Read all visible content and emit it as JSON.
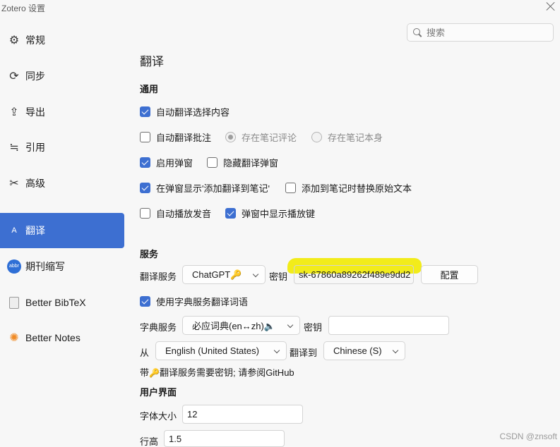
{
  "window": {
    "title": "Zotero 设置"
  },
  "search": {
    "placeholder": "搜索"
  },
  "sidebar": {
    "items": [
      {
        "label": "常规",
        "icon": "gear-icon"
      },
      {
        "label": "同步",
        "icon": "sync-icon"
      },
      {
        "label": "导出",
        "icon": "export-icon"
      },
      {
        "label": "引用",
        "icon": "cite-icon"
      },
      {
        "label": "高级",
        "icon": "tools-icon"
      },
      {
        "label": "翻译",
        "icon": "translate-icon",
        "active": true
      },
      {
        "label": "期刊缩写",
        "icon": "abbr-icon"
      },
      {
        "label": "Better BibTeX",
        "icon": "bibtex-icon"
      },
      {
        "label": "Better Notes",
        "icon": "notes-icon"
      }
    ]
  },
  "pane": {
    "title": "翻译",
    "general": {
      "heading": "通用",
      "auto_translate_selection": {
        "label": "自动翻译选择内容",
        "checked": true
      },
      "auto_translate_annotation": {
        "label": "自动翻译批注",
        "checked": false
      },
      "radio_store_comment": {
        "label": "存在笔记评论",
        "selected": true
      },
      "radio_store_body": {
        "label": "存在笔记本身",
        "selected": false
      },
      "enable_popup": {
        "label": "启用弹窗",
        "checked": true
      },
      "hide_popup": {
        "label": "隐藏翻译弹窗",
        "checked": false
      },
      "show_add_to_note": {
        "label": "在弹窗显示'添加翻译到笔记'",
        "checked": true
      },
      "replace_original": {
        "label": "添加到笔记时替换原始文本",
        "checked": false
      },
      "auto_play": {
        "label": "自动播放发音",
        "checked": false
      },
      "show_play_button": {
        "label": "弹窗中显示播放键",
        "checked": true
      }
    },
    "service": {
      "heading": "服务",
      "translate_service_label": "翻译服务",
      "translate_service_value": "ChatGPT🔑",
      "key_label": "密钥",
      "key_value": "sk-67860a89262f489e9dd2",
      "config_button": "配置",
      "use_dict": {
        "label": "使用字典服务翻译词语",
        "checked": true
      },
      "dict_service_label": "字典服务",
      "dict_service_value": "必应词典(en↔zh)🔈",
      "dict_key_label": "密钥",
      "dict_key_value": "",
      "from_label": "从",
      "from_value": "English (United States)",
      "to_label": "翻译到",
      "to_value": "Chinese (S)",
      "note_prefix": "带",
      "note_rest": "翻译服务需要密钥; 请参阅GitHub"
    },
    "ui": {
      "heading": "用户界面",
      "font_size_label": "字体大小",
      "font_size_value": "12",
      "line_height_label": "行高",
      "line_height_value": "1.5"
    }
  },
  "watermark": "CSDN @znsoft",
  "colors": {
    "accent": "#3d6fd1",
    "highlight": "#f2ec1a"
  }
}
